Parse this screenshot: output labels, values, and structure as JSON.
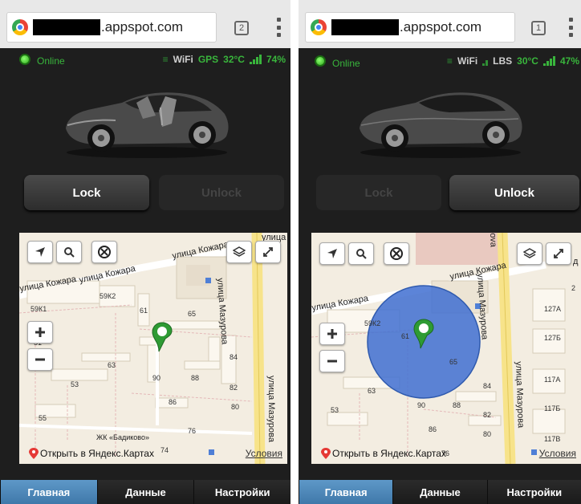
{
  "screens": [
    {
      "browser": {
        "url_suffix": ".appspot.com",
        "tab_count": "2"
      },
      "status": {
        "online_label": "Online",
        "menu_symbol": "≡",
        "wifi": "WiFi",
        "location_mode": "GPS",
        "temperature": "32°C",
        "battery": "74%"
      },
      "car_state": "doors-open",
      "buttons": {
        "lock": "Lock",
        "unlock": "Unlock",
        "active": "lock"
      },
      "map": {
        "streets": [
          "улица Кожара",
          "улица Кожара",
          "улица Кожара",
          "улица Мазурова",
          "улица Мазурова",
          "улица"
        ],
        "house_numbers": [
          "59К1",
          "59К2",
          "61",
          "65",
          "63",
          "90",
          "88",
          "84",
          "82",
          "80",
          "86",
          "53",
          "55",
          "51",
          "76",
          "74"
        ],
        "poi": "ЖК «Бадиково»",
        "open_in_yandex": "Открыть в Яндекс.Картах",
        "terms": "Условия",
        "accuracy_circle": false
      },
      "nav": [
        "Главная",
        "Данные",
        "Настройки"
      ],
      "selected_nav": 0
    },
    {
      "browser": {
        "url_suffix": ".appspot.com",
        "tab_count": "1"
      },
      "status": {
        "online_label": "Online",
        "menu_symbol": "≡",
        "wifi": "WiFi",
        "location_mode": "LBS",
        "temperature": "30°C",
        "battery": "47%"
      },
      "car_state": "closed",
      "buttons": {
        "lock": "Lock",
        "unlock": "Unlock",
        "active": "unlock"
      },
      "map": {
        "streets": [
          "улица Кожара",
          "улица Кожара",
          "улица Мазурова",
          "улица Мазурова",
          "ova",
          "д"
        ],
        "house_numbers": [
          "59К2",
          "61",
          "65",
          "63",
          "90",
          "88",
          "84",
          "82",
          "80",
          "86",
          "53",
          "127А",
          "127Б",
          "117А",
          "117Б",
          "117В",
          "2",
          "76"
        ],
        "open_in_yandex": "Открыть в Яндекс.Картах",
        "terms": "Условия",
        "accuracy_circle": true
      },
      "nav": [
        "Главная",
        "Данные",
        "Настройки"
      ],
      "selected_nav": 0
    }
  ],
  "colors": {
    "online_green": "#39b53c",
    "nav_selected": "#4f88ba",
    "map_bg": "#f3ede1",
    "road_yellow": "#f7e38a",
    "accuracy_blue": "#3f6fd1"
  },
  "icons": [
    "yandex-locate-icon",
    "search-icon",
    "cancel-route-icon",
    "layers-icon",
    "fullscreen-icon",
    "zoom-in-icon",
    "zoom-out-icon",
    "location-pin-icon",
    "yandex-pin-icon"
  ]
}
